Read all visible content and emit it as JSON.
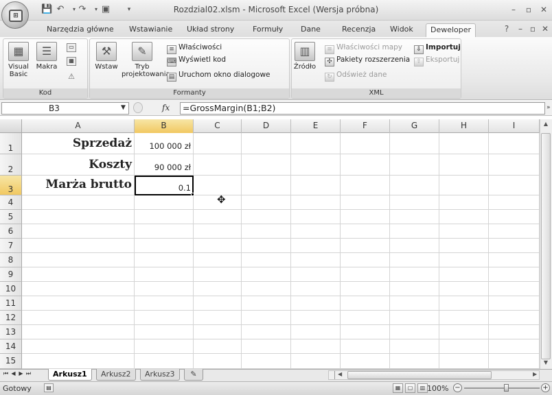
{
  "window": {
    "title": "Rozdzial02.xlsm - Microsoft Excel (Wersja próbna)",
    "controls": [
      "minimize-icon",
      "restore-icon",
      "close-icon"
    ]
  },
  "office_button": {
    "icon": "office-logo-icon"
  },
  "quick_access": [
    "save-icon",
    "undo-icon",
    "redo-icon",
    "customize-icon"
  ],
  "ribbon": {
    "tabs": [
      {
        "label": "Narzędzia główne",
        "active": false
      },
      {
        "label": "Wstawianie",
        "active": false
      },
      {
        "label": "Układ strony",
        "active": false
      },
      {
        "label": "Formuły",
        "active": false
      },
      {
        "label": "Dane",
        "active": false
      },
      {
        "label": "Recenzja",
        "active": false
      },
      {
        "label": "Widok",
        "active": false
      },
      {
        "label": "Deweloper",
        "active": true
      }
    ],
    "groups": {
      "kod": {
        "label": "Kod",
        "visual_basic": "Visual\nBasic",
        "macros": "Makra"
      },
      "formanty": {
        "label": "Formanty",
        "insert": "Wstaw",
        "design_mode": "Tryb projektowania",
        "properties": "Właściwości",
        "view_code": "Wyświetl kod",
        "run_dialog": "Uruchom okno dialogowe"
      },
      "xml": {
        "label": "XML",
        "source": "Źródło",
        "map_properties": "Właściwości mapy",
        "expansion_packs": "Pakiety rozszerzenia",
        "refresh_data": "Odśwież dane",
        "import": "Importuj",
        "export": "Eksportuj"
      }
    }
  },
  "formula_bar": {
    "name_box": "B3",
    "fx_label": "fx",
    "formula": "=GrossMargin(B1;B2)"
  },
  "grid": {
    "columns": [
      "A",
      "B",
      "C",
      "D",
      "E",
      "F",
      "G",
      "H",
      "I"
    ],
    "rows": [
      "1",
      "2",
      "3",
      "4",
      "5",
      "6",
      "7",
      "8",
      "9",
      "10",
      "11",
      "12",
      "13",
      "14",
      "15"
    ],
    "selected_cell": "B3",
    "cells": {
      "A1": "Sprzedaż",
      "A2": "Koszty",
      "A3": "Marża brutto",
      "B1": "100 000 zł",
      "B2": "90 000 zł",
      "B3": "0.1"
    }
  },
  "sheets": {
    "tabs": [
      {
        "label": "Arkusz1",
        "active": true
      },
      {
        "label": "Arkusz2",
        "active": false
      },
      {
        "label": "Arkusz3",
        "active": false
      }
    ]
  },
  "status_bar": {
    "status": "Gotowy",
    "zoom": "100%"
  }
}
